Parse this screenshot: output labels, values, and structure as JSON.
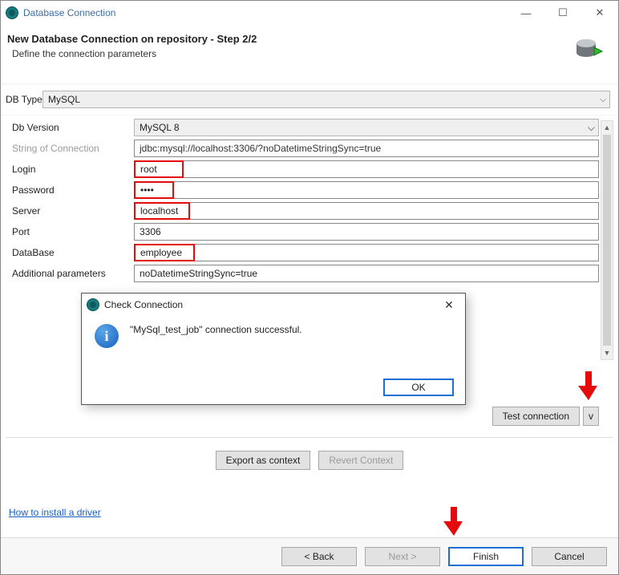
{
  "window": {
    "title": "Database Connection"
  },
  "header": {
    "title": "New Database Connection on repository - Step 2/2",
    "subtitle": "Define the connection parameters"
  },
  "dbtype": {
    "label": "DB Type",
    "value": "MySQL"
  },
  "form": {
    "dbversion": {
      "label": "Db Version",
      "value": "MySQL 8"
    },
    "connstr": {
      "label": "String of Connection",
      "value": "jdbc:mysql://localhost:3306/?noDatetimeStringSync=true"
    },
    "login": {
      "label": "Login",
      "value": "root"
    },
    "password": {
      "label": "Password",
      "value": "••••"
    },
    "server": {
      "label": "Server",
      "value": "localhost"
    },
    "port": {
      "label": "Port",
      "value": "3306"
    },
    "database": {
      "label": "DataBase",
      "value": "employee"
    },
    "addparams": {
      "label": "Additional parameters",
      "value": "noDatetimeStringSync=true"
    }
  },
  "actions": {
    "test": "Test connection",
    "testMenu": "v",
    "export": "Export as context",
    "revert": "Revert Context"
  },
  "link": "How to install a driver",
  "footer": {
    "back": "< Back",
    "next": "Next >",
    "finish": "Finish",
    "cancel": "Cancel"
  },
  "dialog": {
    "title": "Check Connection",
    "message": "\"MySql_test_job\" connection successful.",
    "ok": "OK"
  }
}
